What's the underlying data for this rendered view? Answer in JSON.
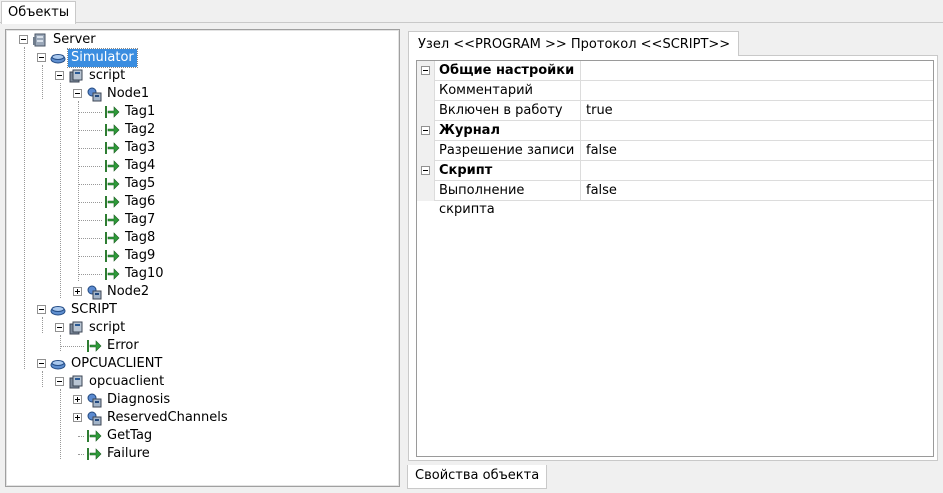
{
  "top_tab": {
    "label": "Объекты"
  },
  "tree": {
    "server": "Server",
    "simulator": "Simulator",
    "sim_script": "script",
    "node1": "Node1",
    "tags": [
      "Tag1",
      "Tag2",
      "Tag3",
      "Tag4",
      "Tag5",
      "Tag6",
      "Tag7",
      "Tag8",
      "Tag9",
      "Tag10"
    ],
    "node2": "Node2",
    "script_group": "SCRIPT",
    "script_script": "script",
    "error": "Error",
    "opcuaclient_group": "OPCUACLIENT",
    "opcuaclient": "opcuaclient",
    "diagnosis": "Diagnosis",
    "reserved": "ReservedChannels",
    "gettag": "GetTag",
    "failure": "Failure"
  },
  "properties": {
    "tab_label": "Узел <<PROGRAM  >> Протокол <<SCRIPT>>",
    "rows": [
      {
        "name": "Общие настройки",
        "value": ""
      },
      {
        "name": "Комментарий",
        "value": ""
      },
      {
        "name": "Включен в работу",
        "value": "true"
      },
      {
        "name": "Журнал",
        "value": ""
      },
      {
        "name": "Разрешение записи",
        "value": "false"
      },
      {
        "name": "Скрипт",
        "value": ""
      },
      {
        "name": "Выполнение скрипта",
        "value": "false"
      }
    ],
    "bottom_tab": "Свойства объекта"
  },
  "colors": {
    "selection": "#3a8de0",
    "tag_arrow": "#2e8b2e"
  },
  "icons": {
    "server": "server-icon",
    "channel": "channel-icon",
    "device": "device-icon",
    "node": "node-icon",
    "tag": "tag-arrow-icon"
  }
}
